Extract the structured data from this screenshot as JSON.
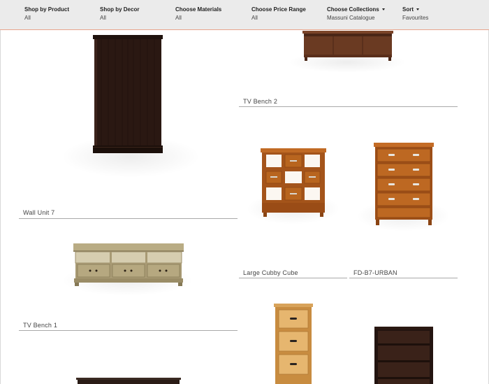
{
  "filters": [
    {
      "label": "Shop by Product",
      "value": "All",
      "has_caret": false
    },
    {
      "label": "Shop by Decor",
      "value": "All",
      "has_caret": false
    },
    {
      "label": "Choose Materials",
      "value": "All",
      "has_caret": false
    },
    {
      "label": "Choose Price Range",
      "value": "All",
      "has_caret": false
    },
    {
      "label": "Choose Collections",
      "value": "Massuni Catalogue",
      "has_caret": true
    },
    {
      "label": "Sort",
      "value": "Favourites",
      "has_caret": true
    }
  ],
  "products": [
    {
      "name": "Wall Unit 7",
      "image_icon": "dark-wall-unit"
    },
    {
      "name": "TV Bench 2",
      "image_icon": "tv-bench-walnut"
    },
    {
      "name": "TV Bench 1",
      "image_icon": "tv-bench-oak"
    },
    {
      "name": "Large Cubby Cube",
      "image_icon": "cubby-cube-pine"
    },
    {
      "name": "FD-B7-URBAN",
      "image_icon": "chest-of-drawers-pine"
    }
  ],
  "colors": {
    "filter_bar_bg": "#ebebeb",
    "filter_bar_border": "#e8a48c",
    "dark_wood": "#2a1812",
    "walnut": "#6a3a22",
    "oak": "#a89a74",
    "pine": "#b4601f",
    "light_pine": "#e3b36c"
  }
}
